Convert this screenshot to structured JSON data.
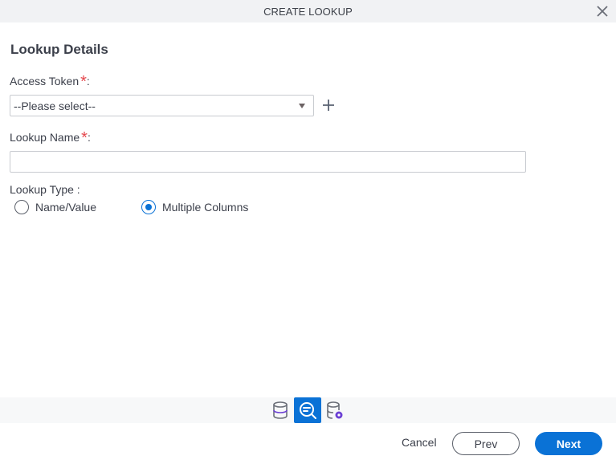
{
  "dialog": {
    "title": "CREATE LOOKUP",
    "close_icon": "close-icon"
  },
  "section": {
    "title": "Lookup Details"
  },
  "fields": {
    "access_token": {
      "label": "Access Token",
      "required_marker": "*",
      "suffix": ":",
      "selected_value": "--Please select--",
      "add_icon": "plus-icon"
    },
    "lookup_name": {
      "label": "Lookup Name",
      "required_marker": "*",
      "suffix": ":",
      "value": "",
      "placeholder": ""
    },
    "lookup_type": {
      "label": "Lookup Type :",
      "options": [
        {
          "label": "Name/Value",
          "checked": false
        },
        {
          "label": "Multiple Columns",
          "checked": true
        }
      ]
    }
  },
  "toolbar": {
    "items": [
      {
        "icon": "database-icon",
        "active": false
      },
      {
        "icon": "lookup-search-icon",
        "active": true
      },
      {
        "icon": "database-settings-icon",
        "active": false
      }
    ]
  },
  "footer": {
    "cancel_label": "Cancel",
    "prev_label": "Prev",
    "next_label": "Next"
  },
  "colors": {
    "accent": "#0a72d6",
    "required": "#e5484d",
    "titlebar_bg": "#f1f2f4",
    "icon_purple": "#6b3fd4"
  }
}
